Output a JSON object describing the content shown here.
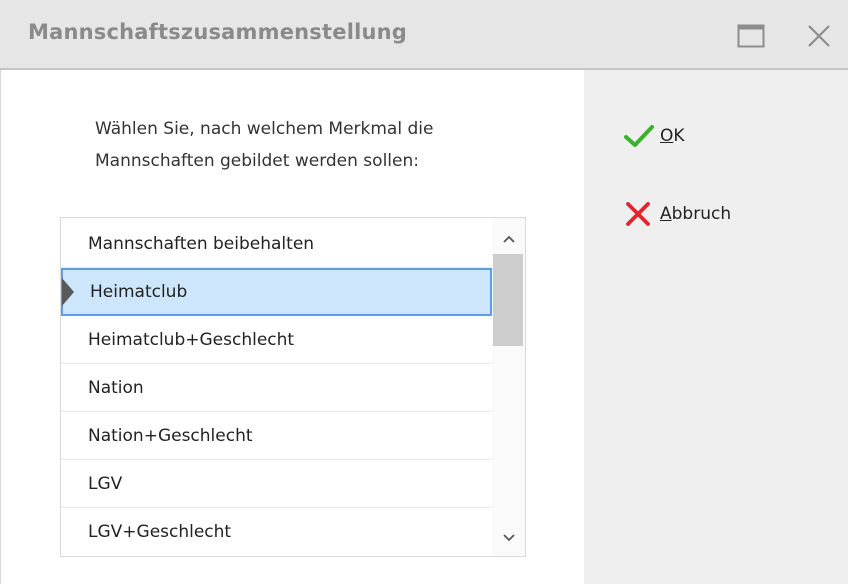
{
  "window": {
    "title": "Mannschaftszusammenstellung",
    "buttons": {
      "maximize_icon": "maximize-icon",
      "close_icon": "close-icon"
    }
  },
  "instruction": {
    "line1": "Wählen Sie, nach welchem Merkmal die",
    "line2": "Mannschaften gebildet werden sollen:"
  },
  "options": [
    "Mannschaften beibehalten",
    "Heimatclub",
    "Heimatclub+Geschlecht",
    "Nation",
    "Nation+Geschlecht",
    "LGV",
    "LGV+Geschlecht"
  ],
  "selected_option": "Heimatclub",
  "actions": {
    "ok": {
      "mnemonic": "O",
      "rest": "K",
      "icon": "checkmark-icon",
      "color": "#3cb02c"
    },
    "cancel": {
      "mnemonic": "A",
      "rest": "bbruch",
      "icon": "x-icon",
      "color": "#e0262b"
    }
  },
  "colors": {
    "selection_bg": "#cde6fb",
    "selection_border": "#5c9edf",
    "titlebar_bg": "#e6e6e6",
    "action_panel_bg": "#efefef"
  }
}
